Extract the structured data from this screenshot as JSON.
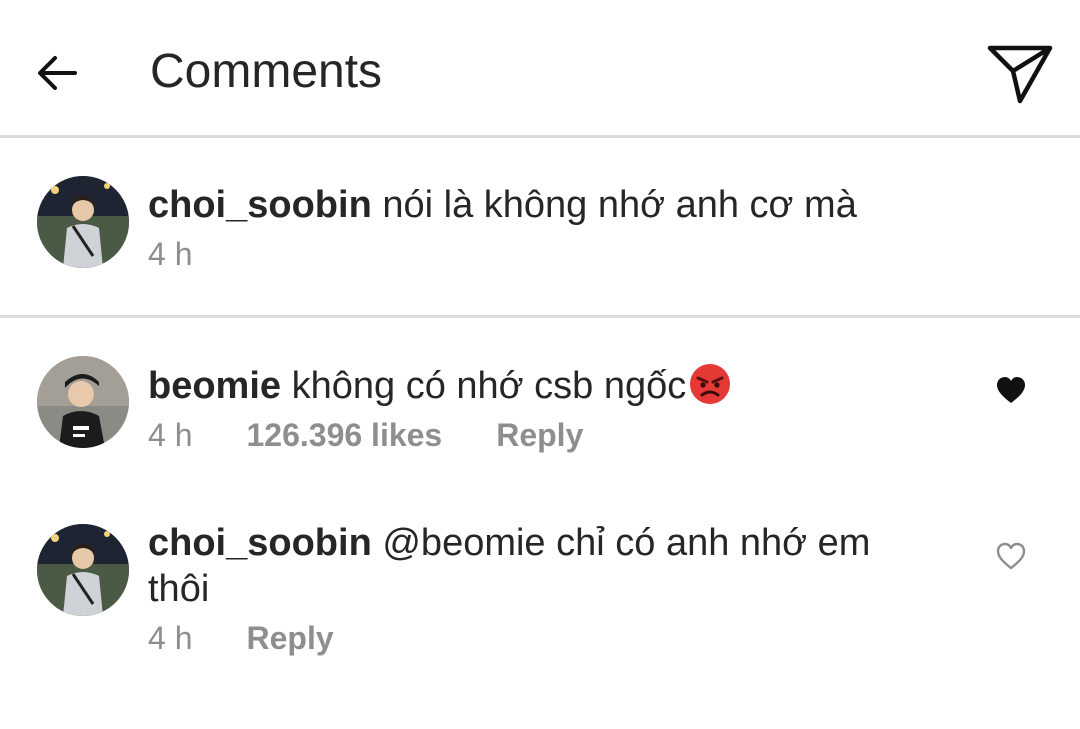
{
  "header": {
    "title": "Comments",
    "back_icon": "back-arrow-icon",
    "send_icon": "paper-plane-icon"
  },
  "caption": {
    "username": "choi_soobin",
    "text": "nói là không nhớ anh cơ mà",
    "time": "4 h"
  },
  "comments": [
    {
      "username": "beomie",
      "text": "không có nhớ csb ngốc",
      "emoji": "angry-face-icon",
      "time": "4 h",
      "likes": "126.396 likes",
      "reply": "Reply",
      "liked": true
    },
    {
      "username": "choi_soobin",
      "text_line1": "@beomie chỉ có anh nhớ em",
      "text_line2": "thôi",
      "time": "4 h",
      "reply": "Reply",
      "liked": false
    }
  ],
  "colors": {
    "primary_text": "#262626",
    "secondary_text": "#8e8e8e",
    "divider": "#dbdbdb",
    "emoji_red": "#e53935"
  }
}
